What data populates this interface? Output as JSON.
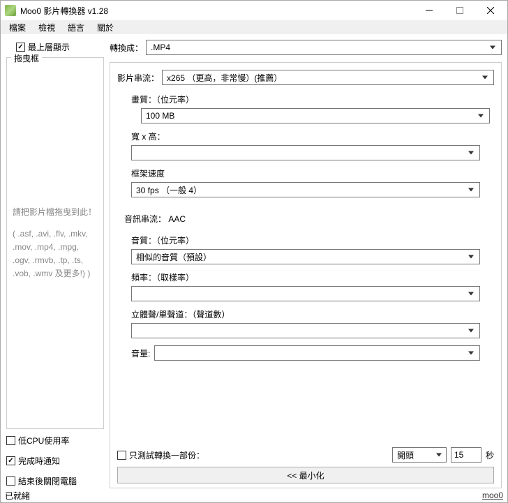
{
  "window": {
    "title": "Moo0 影片轉換器 v1.28"
  },
  "menu": {
    "file": "檔案",
    "view": "檢視",
    "lang": "語言",
    "about": "關於"
  },
  "left": {
    "topmost": "最上層顯示",
    "dragbox": "拖曳框",
    "drophint1": "請把影片檔拖曳到此！",
    "drophint2": "( .asf, .avi, .flv, .mkv, .mov, .mp4, .mpg, .ogv, .rmvb, .tp, .ts, .vob, .wmv 及更多!) )",
    "lowcpu": "低CPU使用率",
    "notify": "完成時通知",
    "shutdown": "結束後關閉電腦"
  },
  "main": {
    "convert_to_label": "轉換成：",
    "convert_to_value": ".MP4",
    "video_stream_label": "影片串流：",
    "video_stream_value": "x265            （更高，非常慢）(推薦）",
    "vq_label": "畫質：（位元率）",
    "vq_value": "100 MB",
    "wh_label": "寬 x 高：",
    "wh_value": "",
    "fps_label": "框架速度",
    "fps_value": "30 fps       （一般 4）",
    "audio_stream_label": "音訊串流： AAC",
    "aq_label": "音質：（位元率）",
    "aq_value": "相似的音質（預設）",
    "freq_label": "頻率：（取樣率）",
    "freq_value": "",
    "channel_label": "立體聲/單聲道：（聲道數）",
    "channel_value": "",
    "volume_label": "音量:",
    "volume_value": "",
    "test_label": "只測試轉換一部份：",
    "test_pos": "開頭",
    "test_secs": "15",
    "test_unit": "秒",
    "minimize_btn": "<< 最小化"
  },
  "status": {
    "ready": "已就緒",
    "link": "moo0"
  }
}
